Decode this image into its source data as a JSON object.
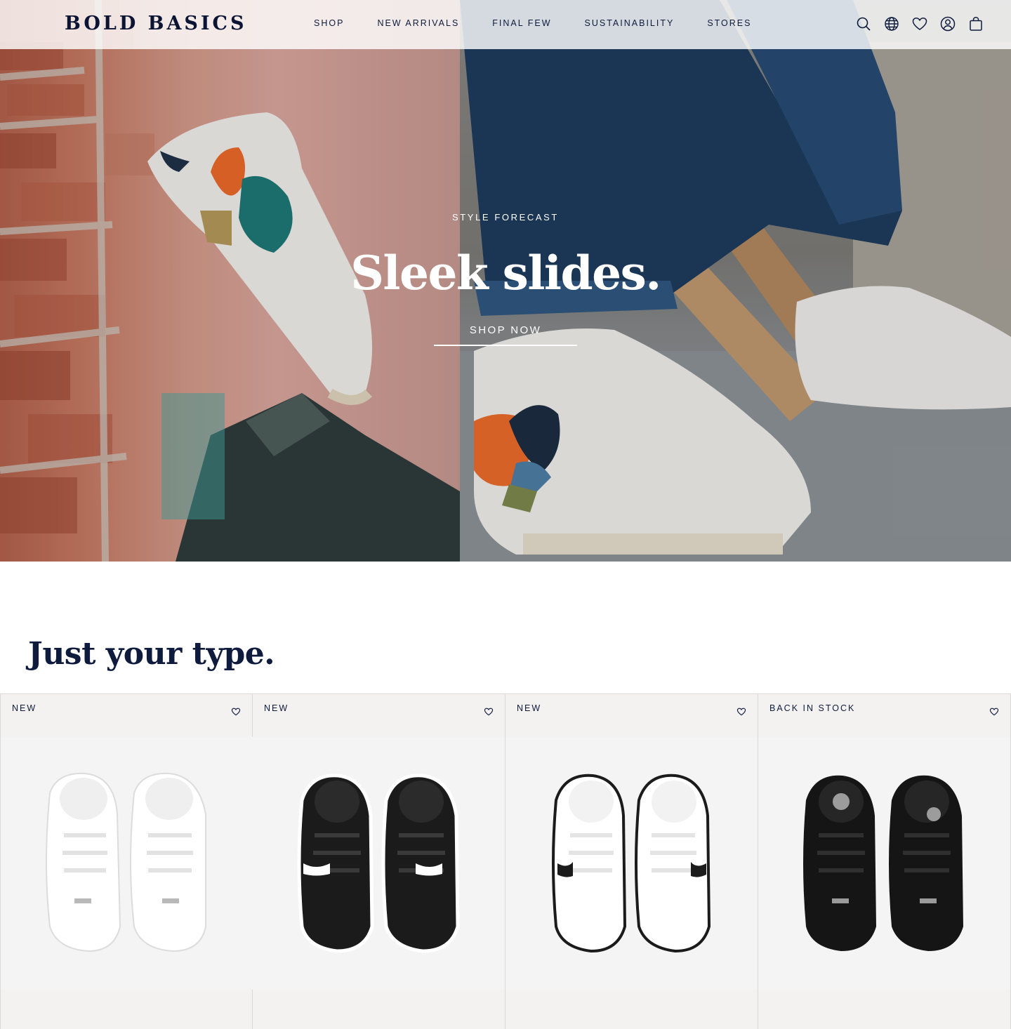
{
  "header": {
    "logo": "BOLD BASICS",
    "nav": [
      "SHOP",
      "NEW ARRIVALS",
      "FINAL FEW",
      "SUSTAINABILITY",
      "STORES"
    ],
    "icons": [
      "search-icon",
      "globe-icon",
      "heart-icon",
      "account-icon",
      "bag-icon"
    ]
  },
  "hero": {
    "eyebrow": "STYLE FORECAST",
    "title": "Sleek slides.",
    "cta": "SHOP NOW"
  },
  "section": {
    "title": "Just your type."
  },
  "products": [
    {
      "badge": "NEW",
      "shoe_color": "white"
    },
    {
      "badge": "NEW",
      "shoe_color": "black-white"
    },
    {
      "badge": "NEW",
      "shoe_color": "white-black"
    },
    {
      "badge": "BACK IN STOCK",
      "shoe_color": "black"
    }
  ],
  "colors": {
    "navy": "#0e1b3d",
    "card_bg": "#f3f2f0"
  }
}
